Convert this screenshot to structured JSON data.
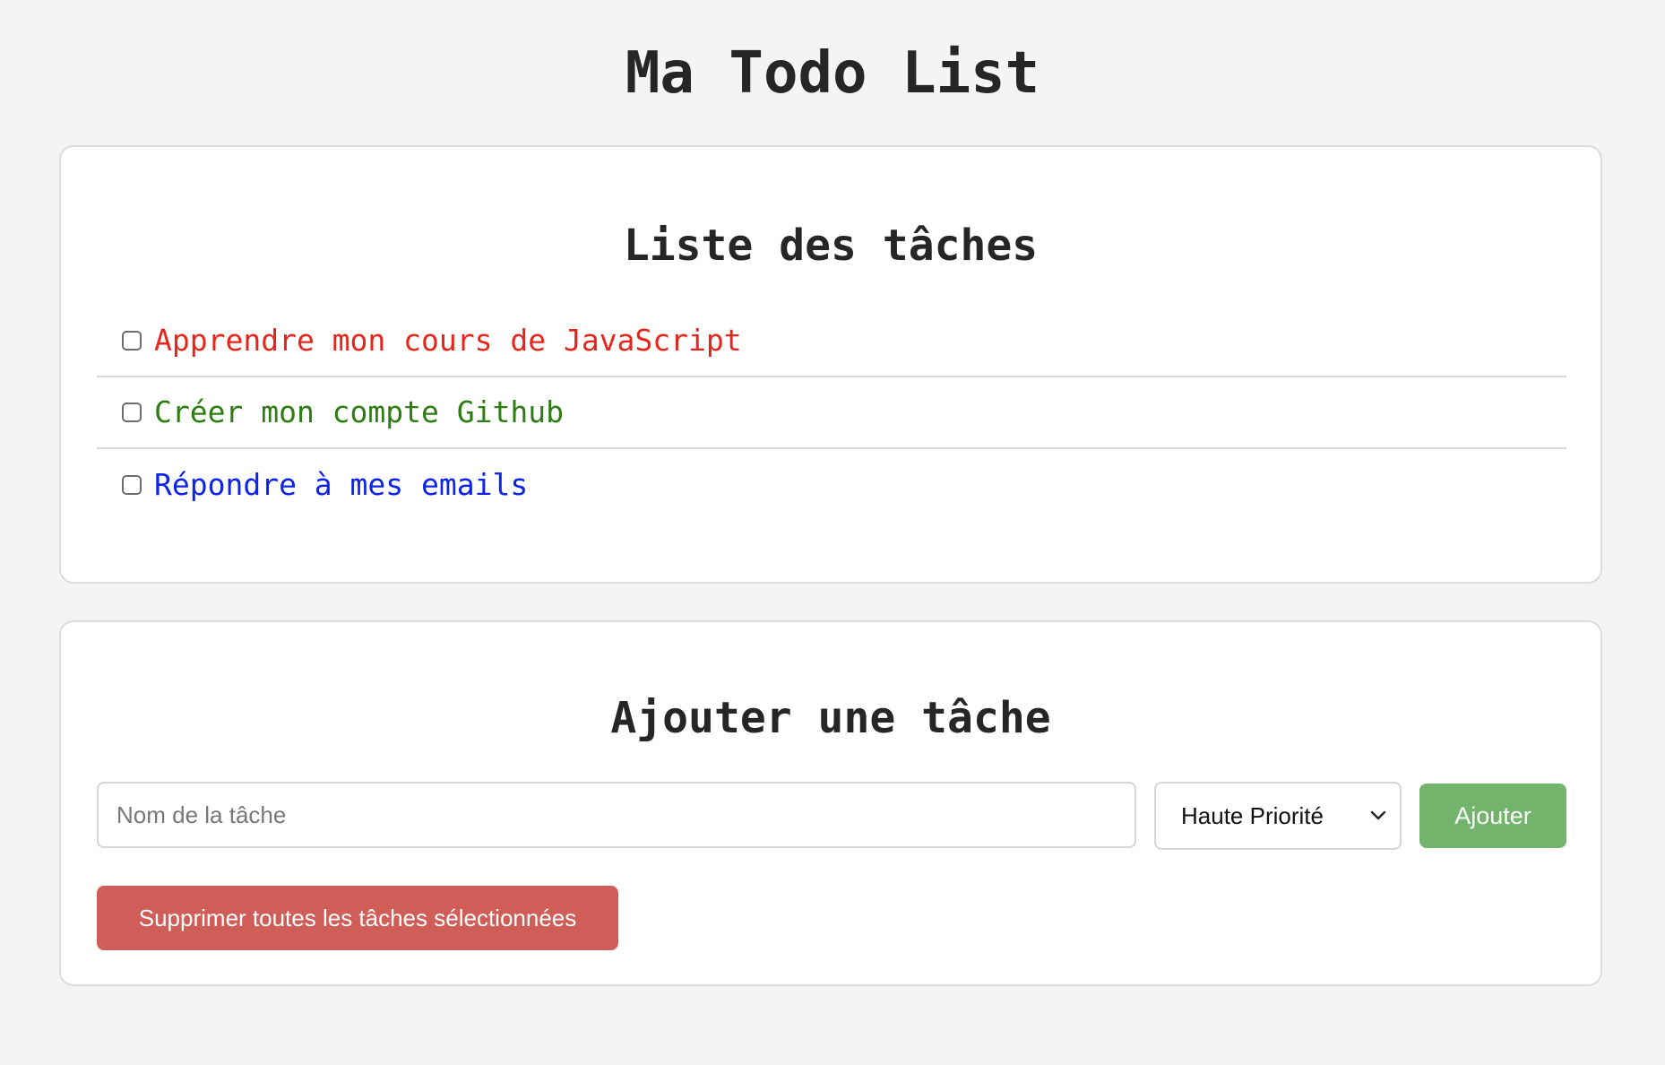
{
  "header": {
    "title": "Ma Todo List"
  },
  "task_list": {
    "title": "Liste des tâches",
    "tasks": [
      {
        "label": "Apprendre mon cours de JavaScript",
        "checked": false,
        "color": "#e4261c"
      },
      {
        "label": "Créer mon compte Github",
        "checked": false,
        "color": "#2d7d14"
      },
      {
        "label": "Répondre à mes emails",
        "checked": false,
        "color": "#0d24e6"
      }
    ]
  },
  "add_task": {
    "title": "Ajouter une tâche",
    "input_placeholder": "Nom de la tâche",
    "input_value": "",
    "priority_selected": "Haute Priorité",
    "add_button_label": "Ajouter",
    "delete_button_label": "Supprimer toutes les tâches sélectionnées",
    "add_button_color": "#72b46b",
    "delete_button_color": "#cf5d58"
  }
}
